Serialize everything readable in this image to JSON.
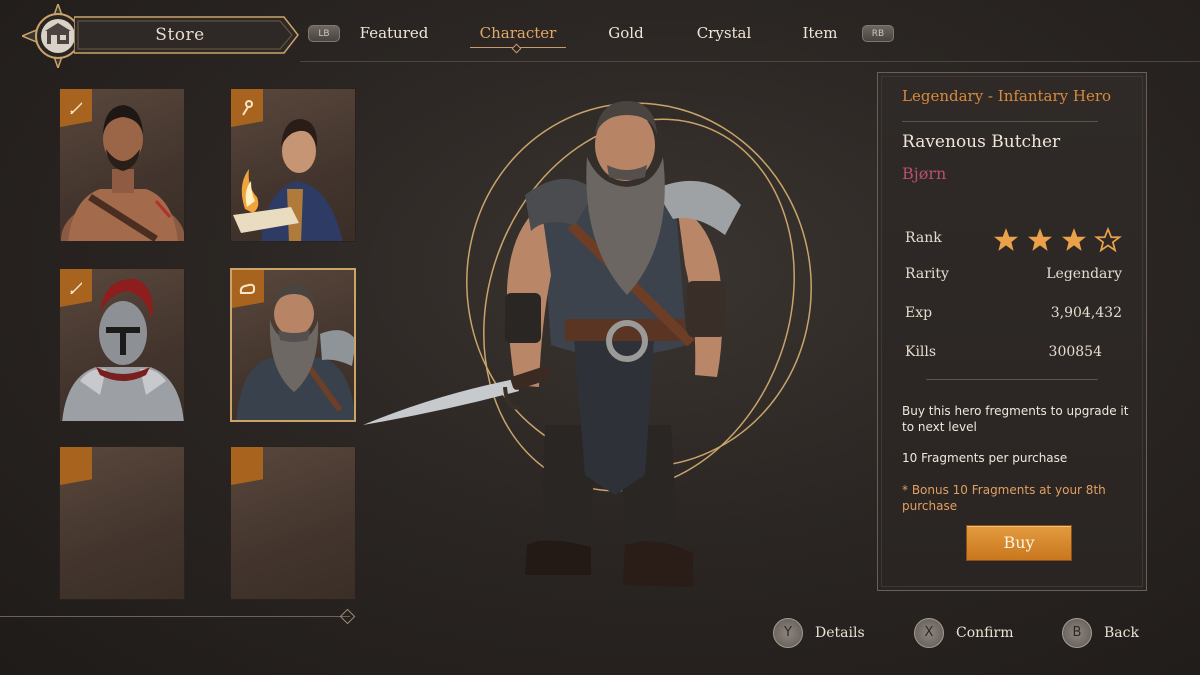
{
  "header": {
    "store_label": "Store",
    "lb_label": "LB",
    "rb_label": "RB",
    "tabs": [
      {
        "label": "Featured",
        "active": false
      },
      {
        "label": "Character",
        "active": true
      },
      {
        "label": "Gold",
        "active": false
      },
      {
        "label": "Crystal",
        "active": false
      },
      {
        "label": "Item",
        "active": false
      }
    ]
  },
  "characters": [
    {
      "icon": "sword-icon",
      "filled": true,
      "selected": false
    },
    {
      "icon": "staff-icon",
      "filled": true,
      "selected": false
    },
    {
      "icon": "sword-icon",
      "filled": true,
      "selected": false
    },
    {
      "icon": "fist-icon",
      "filled": true,
      "selected": true
    },
    {
      "icon": "",
      "filled": false,
      "selected": false
    },
    {
      "icon": "",
      "filled": false,
      "selected": false
    }
  ],
  "details": {
    "class_title": "Legendary - Infantary Hero",
    "name": "Ravenous Butcher",
    "alias": "Bjørn",
    "rank_label": "Rank",
    "rank_stars": 3,
    "rank_max": 4,
    "rarity_label": "Rarity",
    "rarity_value": "Legendary",
    "exp_label": "Exp",
    "exp_value": "3,904,432",
    "kills_label": "Kills",
    "kills_value": "300854",
    "description": "Buy this hero fregments to upgrade it to next level",
    "fragments_text": "10 Fragments per purchase",
    "bonus_text": "* Bonus 10 Fragments at your 8th purchase",
    "buy_label": "Buy"
  },
  "hints": {
    "details": {
      "button": "Y",
      "label": "Details"
    },
    "confirm": {
      "button": "X",
      "label": "Confirm"
    },
    "back": {
      "button": "B",
      "label": "Back"
    }
  },
  "colors": {
    "accent_orange": "#d88a3c",
    "alias_pink": "#b5506b",
    "tab_active": "#e0a86a",
    "button_orange": "#e39b3e"
  }
}
